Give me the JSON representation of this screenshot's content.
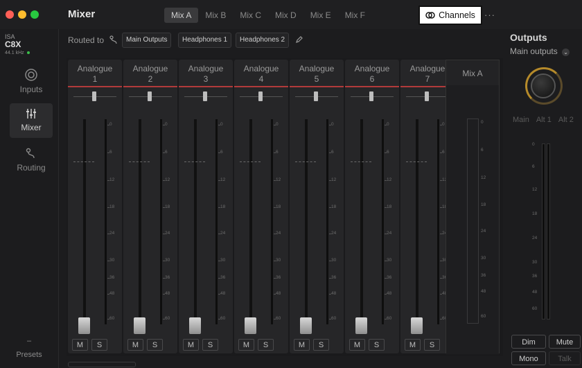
{
  "app": {
    "title": "Mixer",
    "mix_tabs": [
      {
        "label": "Mix A",
        "active": true
      },
      {
        "label": "Mix B",
        "active": false
      },
      {
        "label": "Mix C",
        "active": false
      },
      {
        "label": "Mix D",
        "active": false
      },
      {
        "label": "Mix E",
        "active": false
      },
      {
        "label": "Mix F",
        "active": false
      }
    ],
    "channels_button": "Channels",
    "more_button": "···"
  },
  "device": {
    "brand": "ISA",
    "model": "C8X",
    "sample_rate": "44.1 kHz",
    "status_color": "#3bbf4a"
  },
  "sidebar": {
    "items": [
      {
        "label": "Inputs",
        "icon": "inputs-icon",
        "active": false
      },
      {
        "label": "Mixer",
        "icon": "mixer-icon",
        "active": true
      },
      {
        "label": "Routing",
        "icon": "routing-icon",
        "active": false
      }
    ],
    "presets_dash": "–",
    "presets_label": "Presets"
  },
  "routing": {
    "label": "Routed to",
    "destinations": [
      "Main Outputs",
      "Headphones 1",
      "Headphones 2"
    ]
  },
  "strips": [
    {
      "name": "Analogue",
      "number": "1"
    },
    {
      "name": "Analogue",
      "number": "2"
    },
    {
      "name": "Analogue",
      "number": "3"
    },
    {
      "name": "Analogue",
      "number": "4"
    },
    {
      "name": "Analogue",
      "number": "5"
    },
    {
      "name": "Analogue",
      "number": "6"
    },
    {
      "name": "Analogue",
      "number": "7"
    }
  ],
  "scale_labels": [
    "0",
    "6",
    "12",
    "18",
    "24",
    "30",
    "36",
    "48",
    "60"
  ],
  "mute_label": "M",
  "solo_label": "S",
  "mix": {
    "title": "Mix A"
  },
  "outputs": {
    "title": "Outputs",
    "selected": "Main outputs",
    "tabs": [
      "Main",
      "Alt 1",
      "Alt 2"
    ],
    "dim": "Dim",
    "mute": "Mute",
    "mono": "Mono",
    "talk": "Talk"
  },
  "colors": {
    "accent_red": "#b23a3a",
    "knob_ring": "#b58a2a"
  }
}
